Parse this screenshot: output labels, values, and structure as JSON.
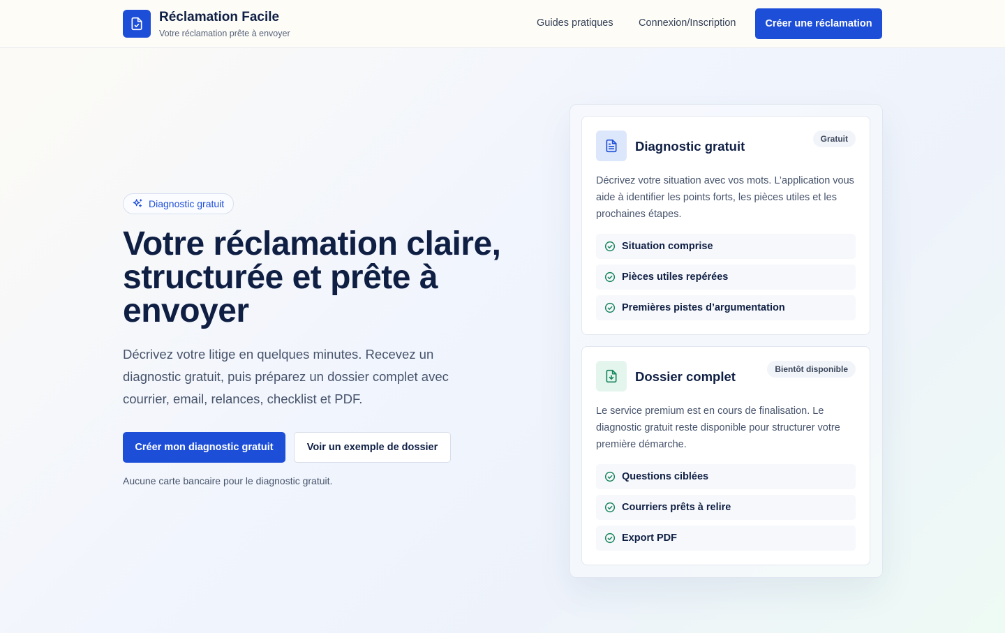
{
  "header": {
    "brand_title": "Réclamation Facile",
    "brand_subtitle": "Votre réclamation prête à envoyer",
    "nav": {
      "guides": "Guides pratiques",
      "login": "Connexion/Inscription",
      "cta": "Créer une réclamation"
    }
  },
  "hero": {
    "pill": "Diagnostic gratuit",
    "title": "Votre réclamation claire, structurée et prête à envoyer",
    "description": "Décrivez votre litige en quelques minutes. Recevez un diagnostic gratuit, puis préparez un dossier complet avec courrier, email, relances, checklist et PDF.",
    "primary_button": "Créer mon diagnostic gratuit",
    "secondary_button": "Voir un exemple de dossier",
    "note": "Aucune carte bancaire pour le diagnostic gratuit."
  },
  "cards": [
    {
      "icon": "document-icon",
      "title": "Diagnostic gratuit",
      "badge": "Gratuit",
      "description": "Décrivez votre situation avec vos mots. L’application vous aide à identifier les points forts, les pièces utiles et les prochaines étapes.",
      "items": [
        "Situation comprise",
        "Pièces utiles repérées",
        "Premières pistes d’argumentation"
      ]
    },
    {
      "icon": "file-download-icon",
      "title": "Dossier complet",
      "badge": "Bientôt disponible",
      "description": "Le service premium est en cours de finalisation. Le diagnostic gratuit reste disponible pour structurer votre première démarche.",
      "items": [
        "Questions ciblées",
        "Courriers prêts à relire",
        "Export PDF"
      ]
    }
  ],
  "colors": {
    "primary": "#1d4ed8",
    "text": "#0f1f44",
    "muted": "#46536b",
    "success": "#16855c"
  }
}
